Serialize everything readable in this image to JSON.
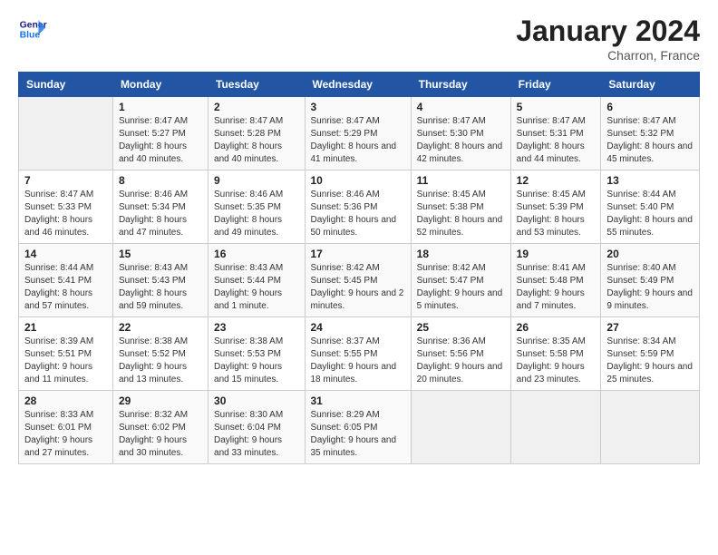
{
  "logo": {
    "line1": "General",
    "line2": "Blue"
  },
  "title": "January 2024",
  "subtitle": "Charron, France",
  "days_header": [
    "Sunday",
    "Monday",
    "Tuesday",
    "Wednesday",
    "Thursday",
    "Friday",
    "Saturday"
  ],
  "weeks": [
    [
      {
        "day": "",
        "sunrise": "",
        "sunset": "",
        "daylight": ""
      },
      {
        "day": "1",
        "sunrise": "Sunrise: 8:47 AM",
        "sunset": "Sunset: 5:27 PM",
        "daylight": "Daylight: 8 hours and 40 minutes."
      },
      {
        "day": "2",
        "sunrise": "Sunrise: 8:47 AM",
        "sunset": "Sunset: 5:28 PM",
        "daylight": "Daylight: 8 hours and 40 minutes."
      },
      {
        "day": "3",
        "sunrise": "Sunrise: 8:47 AM",
        "sunset": "Sunset: 5:29 PM",
        "daylight": "Daylight: 8 hours and 41 minutes."
      },
      {
        "day": "4",
        "sunrise": "Sunrise: 8:47 AM",
        "sunset": "Sunset: 5:30 PM",
        "daylight": "Daylight: 8 hours and 42 minutes."
      },
      {
        "day": "5",
        "sunrise": "Sunrise: 8:47 AM",
        "sunset": "Sunset: 5:31 PM",
        "daylight": "Daylight: 8 hours and 44 minutes."
      },
      {
        "day": "6",
        "sunrise": "Sunrise: 8:47 AM",
        "sunset": "Sunset: 5:32 PM",
        "daylight": "Daylight: 8 hours and 45 minutes."
      }
    ],
    [
      {
        "day": "7",
        "sunrise": "Sunrise: 8:47 AM",
        "sunset": "Sunset: 5:33 PM",
        "daylight": "Daylight: 8 hours and 46 minutes."
      },
      {
        "day": "8",
        "sunrise": "Sunrise: 8:46 AM",
        "sunset": "Sunset: 5:34 PM",
        "daylight": "Daylight: 8 hours and 47 minutes."
      },
      {
        "day": "9",
        "sunrise": "Sunrise: 8:46 AM",
        "sunset": "Sunset: 5:35 PM",
        "daylight": "Daylight: 8 hours and 49 minutes."
      },
      {
        "day": "10",
        "sunrise": "Sunrise: 8:46 AM",
        "sunset": "Sunset: 5:36 PM",
        "daylight": "Daylight: 8 hours and 50 minutes."
      },
      {
        "day": "11",
        "sunrise": "Sunrise: 8:45 AM",
        "sunset": "Sunset: 5:38 PM",
        "daylight": "Daylight: 8 hours and 52 minutes."
      },
      {
        "day": "12",
        "sunrise": "Sunrise: 8:45 AM",
        "sunset": "Sunset: 5:39 PM",
        "daylight": "Daylight: 8 hours and 53 minutes."
      },
      {
        "day": "13",
        "sunrise": "Sunrise: 8:44 AM",
        "sunset": "Sunset: 5:40 PM",
        "daylight": "Daylight: 8 hours and 55 minutes."
      }
    ],
    [
      {
        "day": "14",
        "sunrise": "Sunrise: 8:44 AM",
        "sunset": "Sunset: 5:41 PM",
        "daylight": "Daylight: 8 hours and 57 minutes."
      },
      {
        "day": "15",
        "sunrise": "Sunrise: 8:43 AM",
        "sunset": "Sunset: 5:43 PM",
        "daylight": "Daylight: 8 hours and 59 minutes."
      },
      {
        "day": "16",
        "sunrise": "Sunrise: 8:43 AM",
        "sunset": "Sunset: 5:44 PM",
        "daylight": "Daylight: 9 hours and 1 minute."
      },
      {
        "day": "17",
        "sunrise": "Sunrise: 8:42 AM",
        "sunset": "Sunset: 5:45 PM",
        "daylight": "Daylight: 9 hours and 2 minutes."
      },
      {
        "day": "18",
        "sunrise": "Sunrise: 8:42 AM",
        "sunset": "Sunset: 5:47 PM",
        "daylight": "Daylight: 9 hours and 5 minutes."
      },
      {
        "day": "19",
        "sunrise": "Sunrise: 8:41 AM",
        "sunset": "Sunset: 5:48 PM",
        "daylight": "Daylight: 9 hours and 7 minutes."
      },
      {
        "day": "20",
        "sunrise": "Sunrise: 8:40 AM",
        "sunset": "Sunset: 5:49 PM",
        "daylight": "Daylight: 9 hours and 9 minutes."
      }
    ],
    [
      {
        "day": "21",
        "sunrise": "Sunrise: 8:39 AM",
        "sunset": "Sunset: 5:51 PM",
        "daylight": "Daylight: 9 hours and 11 minutes."
      },
      {
        "day": "22",
        "sunrise": "Sunrise: 8:38 AM",
        "sunset": "Sunset: 5:52 PM",
        "daylight": "Daylight: 9 hours and 13 minutes."
      },
      {
        "day": "23",
        "sunrise": "Sunrise: 8:38 AM",
        "sunset": "Sunset: 5:53 PM",
        "daylight": "Daylight: 9 hours and 15 minutes."
      },
      {
        "day": "24",
        "sunrise": "Sunrise: 8:37 AM",
        "sunset": "Sunset: 5:55 PM",
        "daylight": "Daylight: 9 hours and 18 minutes."
      },
      {
        "day": "25",
        "sunrise": "Sunrise: 8:36 AM",
        "sunset": "Sunset: 5:56 PM",
        "daylight": "Daylight: 9 hours and 20 minutes."
      },
      {
        "day": "26",
        "sunrise": "Sunrise: 8:35 AM",
        "sunset": "Sunset: 5:58 PM",
        "daylight": "Daylight: 9 hours and 23 minutes."
      },
      {
        "day": "27",
        "sunrise": "Sunrise: 8:34 AM",
        "sunset": "Sunset: 5:59 PM",
        "daylight": "Daylight: 9 hours and 25 minutes."
      }
    ],
    [
      {
        "day": "28",
        "sunrise": "Sunrise: 8:33 AM",
        "sunset": "Sunset: 6:01 PM",
        "daylight": "Daylight: 9 hours and 27 minutes."
      },
      {
        "day": "29",
        "sunrise": "Sunrise: 8:32 AM",
        "sunset": "Sunset: 6:02 PM",
        "daylight": "Daylight: 9 hours and 30 minutes."
      },
      {
        "day": "30",
        "sunrise": "Sunrise: 8:30 AM",
        "sunset": "Sunset: 6:04 PM",
        "daylight": "Daylight: 9 hours and 33 minutes."
      },
      {
        "day": "31",
        "sunrise": "Sunrise: 8:29 AM",
        "sunset": "Sunset: 6:05 PM",
        "daylight": "Daylight: 9 hours and 35 minutes."
      },
      {
        "day": "",
        "sunrise": "",
        "sunset": "",
        "daylight": ""
      },
      {
        "day": "",
        "sunrise": "",
        "sunset": "",
        "daylight": ""
      },
      {
        "day": "",
        "sunrise": "",
        "sunset": "",
        "daylight": ""
      }
    ]
  ]
}
